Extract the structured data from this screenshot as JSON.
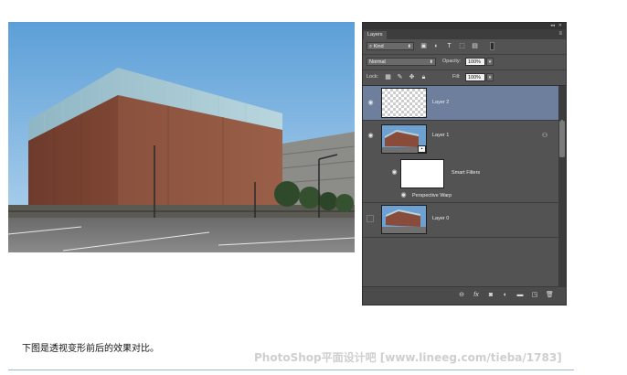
{
  "panel": {
    "tab_label": "Layers",
    "filter_kind": "Kind",
    "blend_mode": "Normal",
    "opacity_label": "Opacity:",
    "opacity_value": "100%",
    "lock_label": "Lock:",
    "fill_label": "Fill:",
    "fill_value": "100%",
    "layers": [
      {
        "name": "Layer 2",
        "selected": true,
        "visible": true
      },
      {
        "name": "Layer 1",
        "selected": false,
        "visible": true,
        "has_smart_filters": true
      },
      {
        "name": "Smart Filters"
      },
      {
        "name": "Perspective Warp"
      },
      {
        "name": "Layer 0",
        "selected": false,
        "visible": false
      }
    ],
    "icons": {
      "filter": [
        "image-icon",
        "adjustment-icon",
        "type-icon",
        "shape-icon",
        "smart-object-icon"
      ],
      "lock": [
        "lock-transparent-icon",
        "lock-brush-icon",
        "lock-move-icon",
        "lock-all-icon"
      ],
      "bottom": [
        "link-icon",
        "fx-icon",
        "mask-icon",
        "adjustment-layer-icon",
        "folder-icon",
        "new-layer-icon",
        "trash-icon"
      ]
    }
  },
  "caption": "下图是透视变形前后的效果对比。",
  "watermark": "PhotoShop平面设计吧 [www.lineeg.com/tieba/1783]"
}
